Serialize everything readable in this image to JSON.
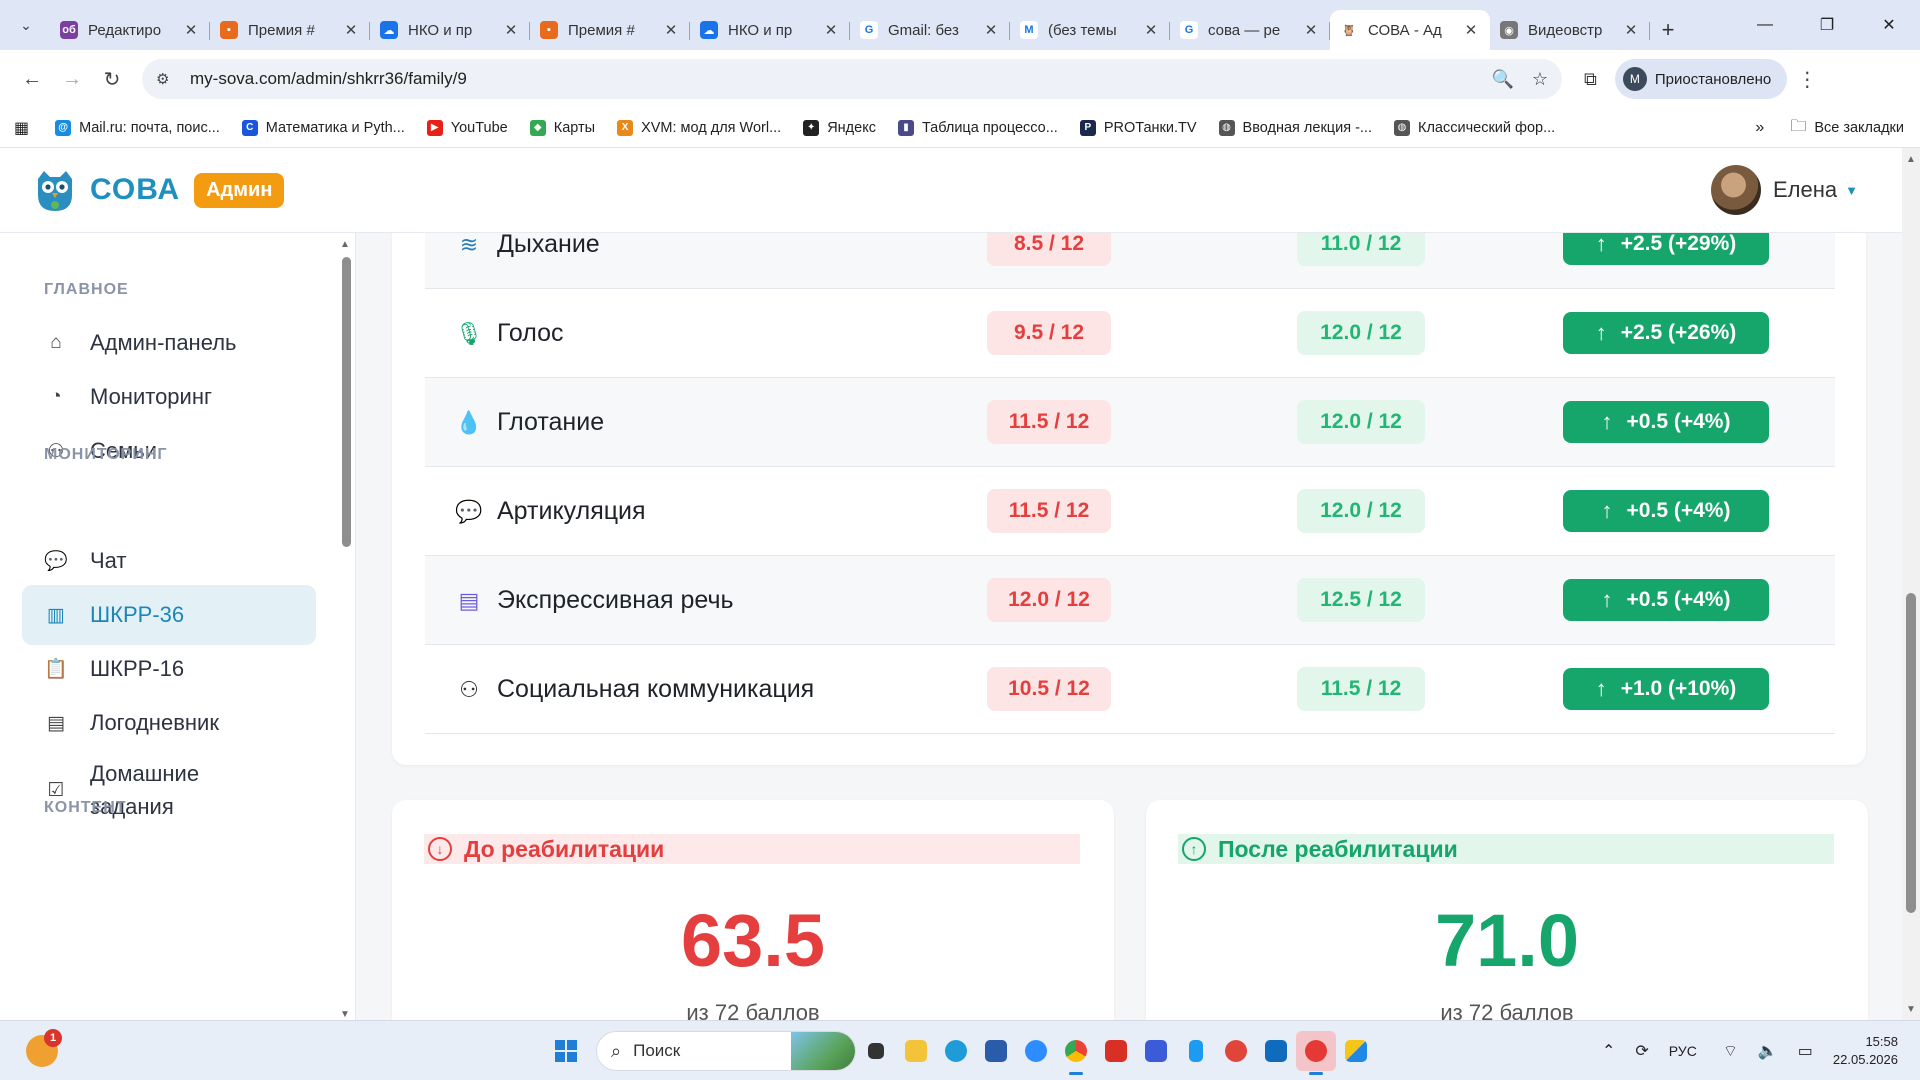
{
  "browser": {
    "tabs": [
      {
        "title": "Редактиро",
        "fav_color": "#7b3fa0",
        "fav_glyph": "об"
      },
      {
        "title": "Премия #",
        "fav_color": "#e86a1c",
        "fav_glyph": "▪"
      },
      {
        "title": "НКО и пр",
        "fav_color": "#1a73e8",
        "fav_glyph": "☁"
      },
      {
        "title": "Премия #",
        "fav_color": "#e86a1c",
        "fav_glyph": "▪"
      },
      {
        "title": "НКО и пр",
        "fav_color": "#1a73e8",
        "fav_glyph": "☁"
      },
      {
        "title": "Gmail: без",
        "fav_color": "#ffffff",
        "fav_glyph": "G"
      },
      {
        "title": "(без темы",
        "fav_color": "#ffffff",
        "fav_glyph": "M"
      },
      {
        "title": "сова — ре",
        "fav_color": "#ffffff",
        "fav_glyph": "G"
      },
      {
        "title": "СОВА - Ад",
        "fav_color": "#ffffff",
        "fav_glyph": "🦉",
        "active": true
      },
      {
        "title": "Видеовстр",
        "fav_color": "#777777",
        "fav_glyph": "◉"
      }
    ],
    "url": "my-sova.com/admin/shkrr36/family/9",
    "profile_label": "Приостановлено",
    "profile_initial": "M",
    "bookmarks": [
      {
        "label": "Mail.ru: почта, поис...",
        "color": "#168de2",
        "glyph": "@"
      },
      {
        "label": "Математика и Pyth...",
        "color": "#1a56db",
        "glyph": "C"
      },
      {
        "label": "YouTube",
        "color": "#e62117",
        "glyph": "▶"
      },
      {
        "label": "Карты",
        "color": "#34a853",
        "glyph": "◆"
      },
      {
        "label": "XVM: мод для Worl...",
        "color": "#e8891c",
        "glyph": "X"
      },
      {
        "label": "Яндекс",
        "color": "#222222",
        "glyph": "✦"
      },
      {
        "label": "Таблица процессо...",
        "color": "#4a4a8a",
        "glyph": "▮"
      },
      {
        "label": "PROТанки.TV",
        "color": "#1b2a4a",
        "glyph": "P"
      },
      {
        "label": "Вводная лекция -...",
        "color": "#555555",
        "glyph": "◍"
      },
      {
        "label": "Классический фор...",
        "color": "#555555",
        "glyph": "◍"
      }
    ],
    "all_bookmarks_label": "Все закладки"
  },
  "app": {
    "logo_text": "СОВА",
    "admin_badge": "Админ",
    "user_name": "Елена"
  },
  "sidebar": {
    "sections": [
      {
        "title": "ГЛАВНОЕ"
      },
      {
        "title": "МОНИТОРИНГ"
      },
      {
        "title": "КОНТЕНТ"
      }
    ],
    "items": [
      {
        "label": "Админ-панель",
        "icon": "home-icon"
      },
      {
        "label": "Мониторинг",
        "icon": "gauge-icon"
      },
      {
        "label": "Семьи",
        "icon": "users-icon"
      },
      {
        "label": "Чат",
        "icon": "chat-icon"
      },
      {
        "label": "ШКРР-36",
        "icon": "chart-icon",
        "active": true
      },
      {
        "label": "ШКРР-16",
        "icon": "clipboard-icon"
      },
      {
        "label": "Логодневник",
        "icon": "journal-icon"
      },
      {
        "label": "Домашние задания",
        "icon": "task-icon"
      }
    ]
  },
  "progress_table": {
    "rows": [
      {
        "name": "Дыхание",
        "icon": "wind-icon",
        "icon_color": "#2a7db8",
        "before": "8.5 / 12",
        "after": "11.0 / 12",
        "delta": "+2.5 (+29%)"
      },
      {
        "name": "Голос",
        "icon": "microphone-icon",
        "icon_color": "#16a56b",
        "before": "9.5 / 12",
        "after": "12.0 / 12",
        "delta": "+2.5 (+26%)"
      },
      {
        "name": "Глотание",
        "icon": "droplet-icon",
        "icon_color": "#f39c12",
        "before": "11.5 / 12",
        "after": "12.0 / 12",
        "delta": "+0.5 (+4%)"
      },
      {
        "name": "Артикуляция",
        "icon": "speech-bubble-icon",
        "icon_color": "#e53e3e",
        "before": "11.5 / 12",
        "after": "12.0 / 12",
        "delta": "+0.5 (+4%)"
      },
      {
        "name": "Экспрессивная речь",
        "icon": "message-icon",
        "icon_color": "#6c5ce7",
        "before": "12.0 / 12",
        "after": "12.5 / 12",
        "delta": "+0.5 (+4%)"
      },
      {
        "name": "Социальная коммуникация",
        "icon": "people-icon",
        "icon_color": "#333333",
        "before": "10.5 / 12",
        "after": "11.5 / 12",
        "delta": "+1.0 (+10%)"
      }
    ]
  },
  "score_before": {
    "title": "До реабилитации",
    "value": "63.5",
    "sub": "из 72 баллов"
  },
  "score_after": {
    "title": "После реабилитации",
    "value": "71.0",
    "sub": "из 72 баллов"
  },
  "taskbar": {
    "search_placeholder": "Поиск",
    "weather_badge": "1",
    "language": "РУС",
    "time": "15:58",
    "date": "22.05.2026"
  },
  "colors": {
    "brand": "#1f8fbf",
    "admin_badge": "#f39c12",
    "before_red": "#e53e3e",
    "after_green": "#16a56b",
    "active_nav_bg": "#e3f1f7"
  }
}
